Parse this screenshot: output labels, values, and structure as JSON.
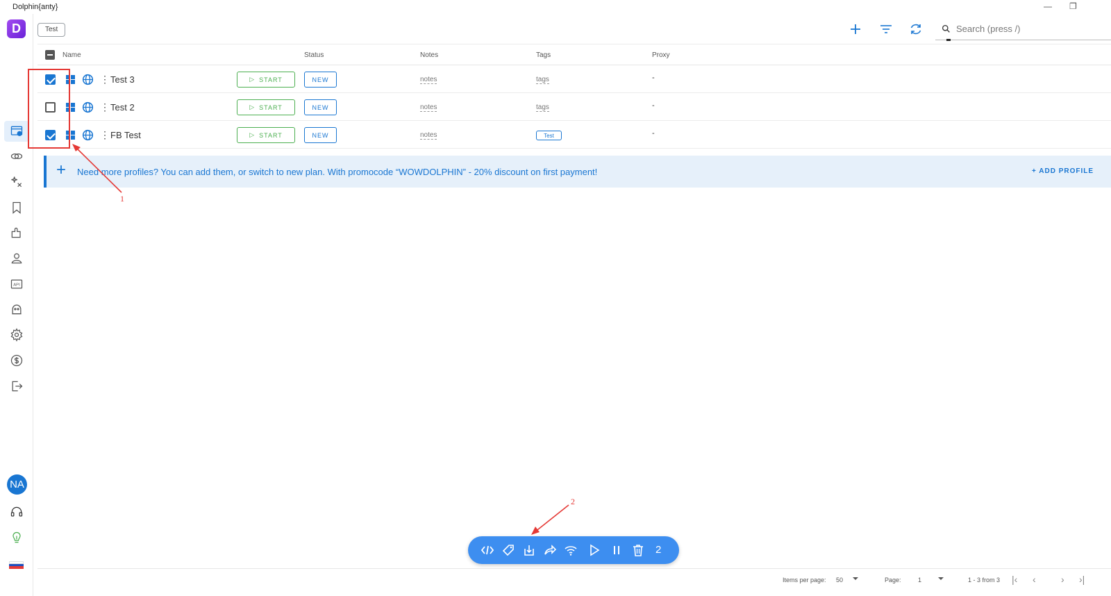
{
  "window": {
    "title": "Dolphin{anty}",
    "minimize_glyph": "—",
    "restore_glyph": "❐"
  },
  "sidebar": {
    "logo_letter": "D",
    "avatar_initials": "NA",
    "items": [
      {
        "name": "browser-profiles-icon",
        "active": true
      },
      {
        "name": "proxies-icon"
      },
      {
        "name": "automation-icon"
      },
      {
        "name": "bookmarks-icon"
      },
      {
        "name": "extensions-icon"
      },
      {
        "name": "team-icon"
      },
      {
        "name": "api-icon"
      },
      {
        "name": "cookie-robot-icon"
      },
      {
        "name": "settings-icon"
      },
      {
        "name": "billing-icon"
      },
      {
        "name": "logout-icon"
      }
    ],
    "api_label": "API",
    "flag_colors": [
      "#ffffff",
      "#1f4fbf",
      "#e53935"
    ]
  },
  "topbar": {
    "folder_chip": "Test",
    "search_placeholder": "Search (press /)",
    "accent_color": "#1976d2"
  },
  "table": {
    "columns": {
      "name": "Name",
      "status": "Status",
      "notes": "Notes",
      "tags": "Tags",
      "proxy": "Proxy"
    },
    "rows": [
      {
        "checked": true,
        "name": "Test 3",
        "start_label": "START",
        "status": "NEW",
        "notes": "notes",
        "tags": "tags",
        "tag_chip": "",
        "proxy": "-"
      },
      {
        "checked": false,
        "name": "Test 2",
        "start_label": "START",
        "status": "NEW",
        "notes": "notes",
        "tags": "tags",
        "tag_chip": "",
        "proxy": "-"
      },
      {
        "checked": true,
        "name": "FB Test",
        "start_label": "START",
        "status": "NEW",
        "notes": "notes",
        "tags": "",
        "tag_chip": "Test",
        "proxy": "-"
      }
    ]
  },
  "promo": {
    "message": "Need more profiles? You can add them, or switch to new plan. With promocode “WOWDOLPHIN” - 20% discount on first payment!",
    "add_link": "+ ADD PROFILE"
  },
  "annotations": {
    "label_1": "1",
    "label_2": "2",
    "color": "#e53935"
  },
  "action_bar": {
    "selected_count": "2",
    "icons": [
      "code-icon",
      "tag-icon",
      "export-icon",
      "share-icon",
      "proxy-wifi-icon",
      "play-icon",
      "pause-icon",
      "trash-icon"
    ]
  },
  "footer": {
    "items_per_page_label": "Items per page:",
    "items_per_page_value": "50",
    "page_label": "Page:",
    "page_value": "1",
    "range_text": "1 - 3 from 3"
  }
}
